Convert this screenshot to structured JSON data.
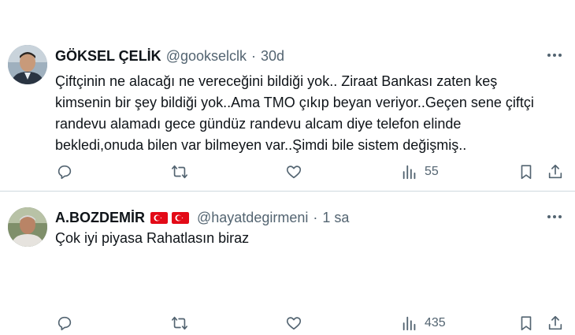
{
  "tweets": [
    {
      "name": "GÖKSEL ÇELİK",
      "handle": "@gookselclk",
      "separator": "·",
      "time": "30d",
      "lines": [
        "Çiftçinin ne alacağı ne vereceğini bildiği yok.. Ziraat Bankası zaten keş",
        "kimsenin bir şey bildiği yok..Ama TMO çıkıp beyan veriyor..Geçen sene çiftçi",
        "randevu alamadı gece gündüz randevu alcam diye telefon elinde",
        "bekledi,onuda bilen var bilmeyen var..Şimdi bile sistem değişmiş.."
      ],
      "views": "55"
    },
    {
      "name": "A.BOZDEMİR",
      "flags": [
        "turkey-flag-icon",
        "turkey-flag-icon"
      ],
      "handle": "@hayatdegirmeni",
      "separator": "·",
      "time": "1 sa",
      "lines": [
        "Çok iyi piyasa Rahatlasın biraz"
      ],
      "views": "435"
    }
  ],
  "colors": {
    "text": "#0f1419",
    "secondary": "#536471",
    "divider": "#cfd9de",
    "flag_red": "#e30a17"
  },
  "icons": [
    "reply-icon",
    "retweet-icon",
    "like-icon",
    "views-icon",
    "bookmark-icon",
    "share-icon",
    "more-icon"
  ]
}
